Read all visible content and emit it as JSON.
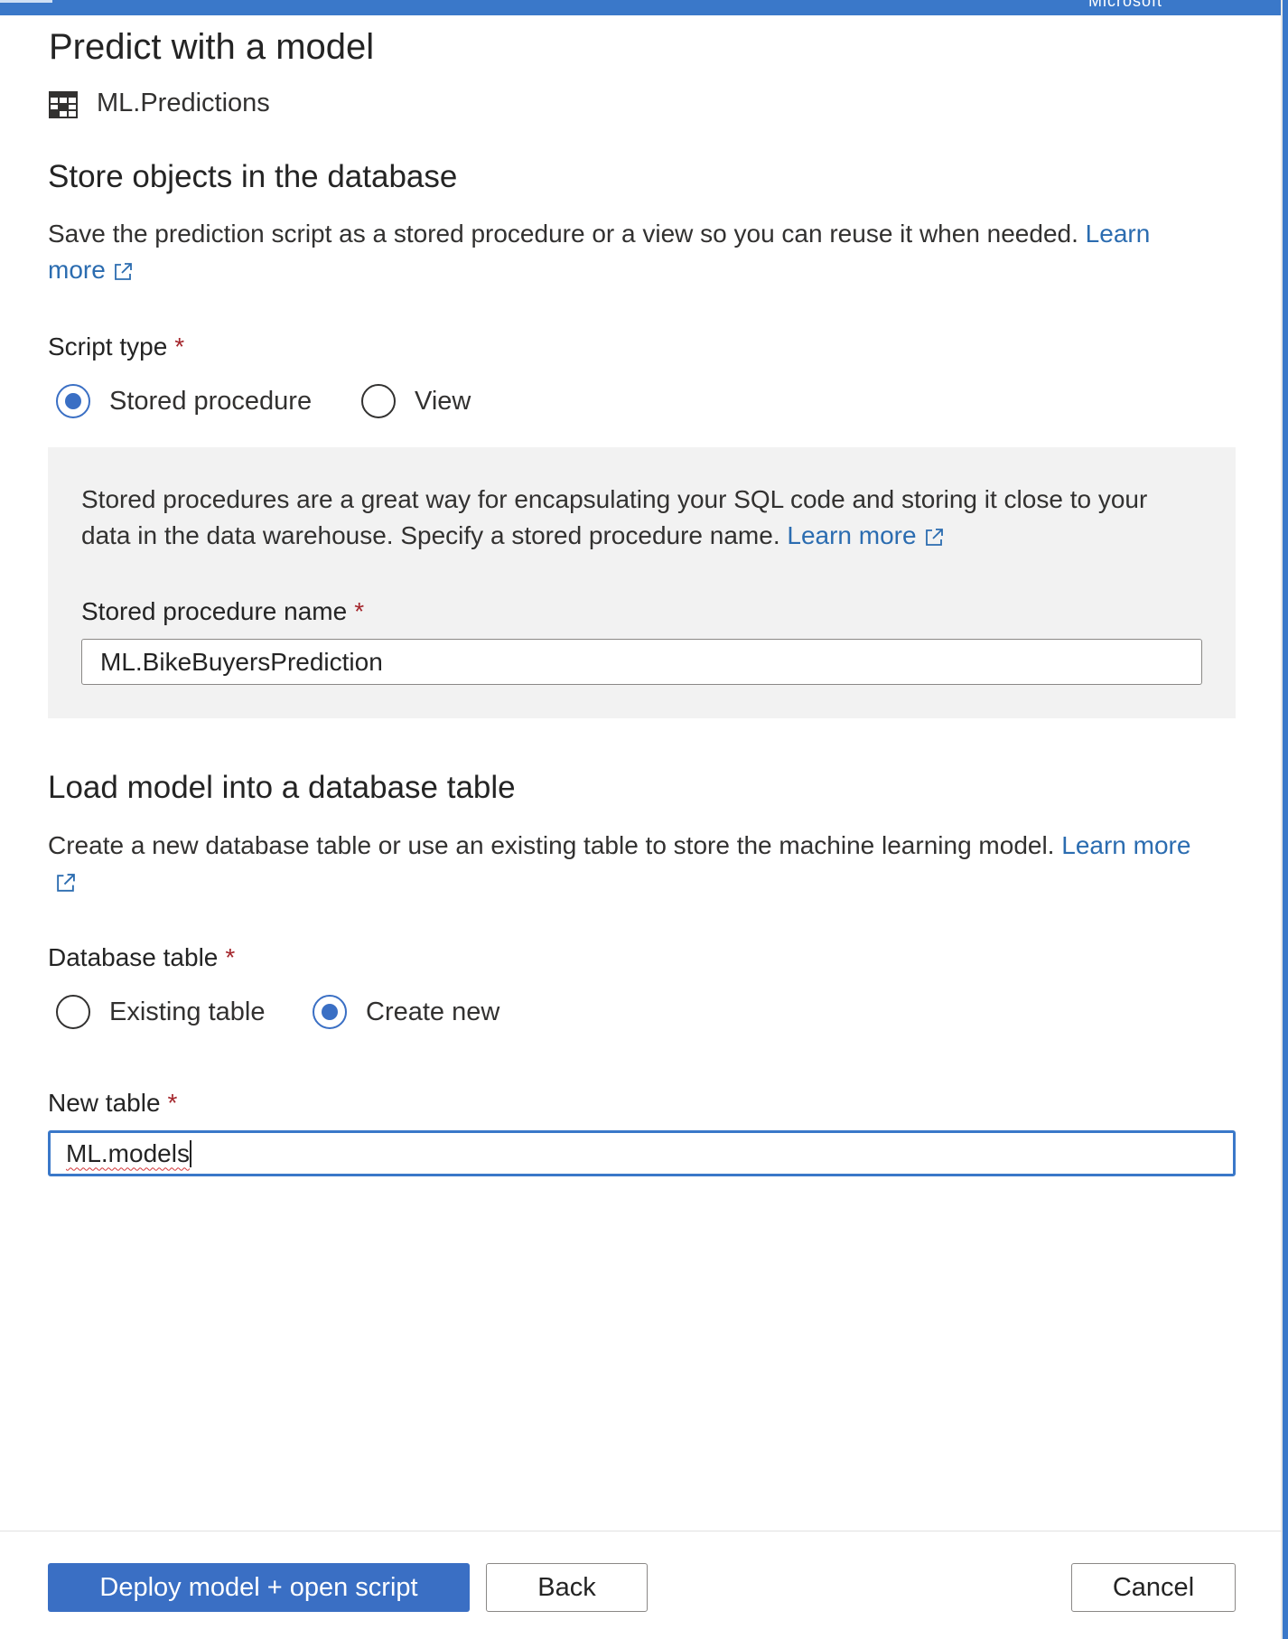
{
  "header": {
    "brand": "Microsoft"
  },
  "panel": {
    "title": "Predict with a model",
    "source": {
      "icon": "table-icon",
      "name": "ML.Predictions"
    }
  },
  "store_section": {
    "heading": "Store objects in the database",
    "description": "Save the prediction script as a stored procedure or a view so you can reuse it when needed.",
    "learn_more_part1": "Learn",
    "learn_more_part2": "more",
    "script_type": {
      "label": "Script type",
      "required_mark": "*",
      "options": [
        {
          "label": "Stored procedure",
          "selected": true
        },
        {
          "label": "View",
          "selected": false
        }
      ]
    },
    "callout": {
      "line1": "Stored procedures are a great way for encapsulating your SQL code and storing it close to your",
      "line2": "data in the data warehouse. Specify a stored procedure name.",
      "learn_more": "Learn more",
      "field_label": "Stored procedure name",
      "required_mark": "*",
      "field_value": "ML.BikeBuyersPrediction"
    }
  },
  "load_section": {
    "heading": "Load model into a database table",
    "description": "Create a new database table or use an existing table to store the machine learning model.",
    "learn_more": "Learn more",
    "database_table": {
      "label": "Database table",
      "required_mark": "*",
      "options": [
        {
          "label": "Existing table",
          "selected": false
        },
        {
          "label": "Create new",
          "selected": true
        }
      ]
    },
    "new_table": {
      "label": "New table",
      "required_mark": "*",
      "value": "ML.models"
    }
  },
  "footer": {
    "deploy_label": "Deploy model + open script",
    "back_label": "Back",
    "cancel_label": "Cancel"
  },
  "colors": {
    "accent": "#3a78c9",
    "primary_button": "#3a6fc4",
    "link": "#2b6cb0",
    "callout_bg": "#f2f2f2",
    "required": "#a4262c"
  }
}
